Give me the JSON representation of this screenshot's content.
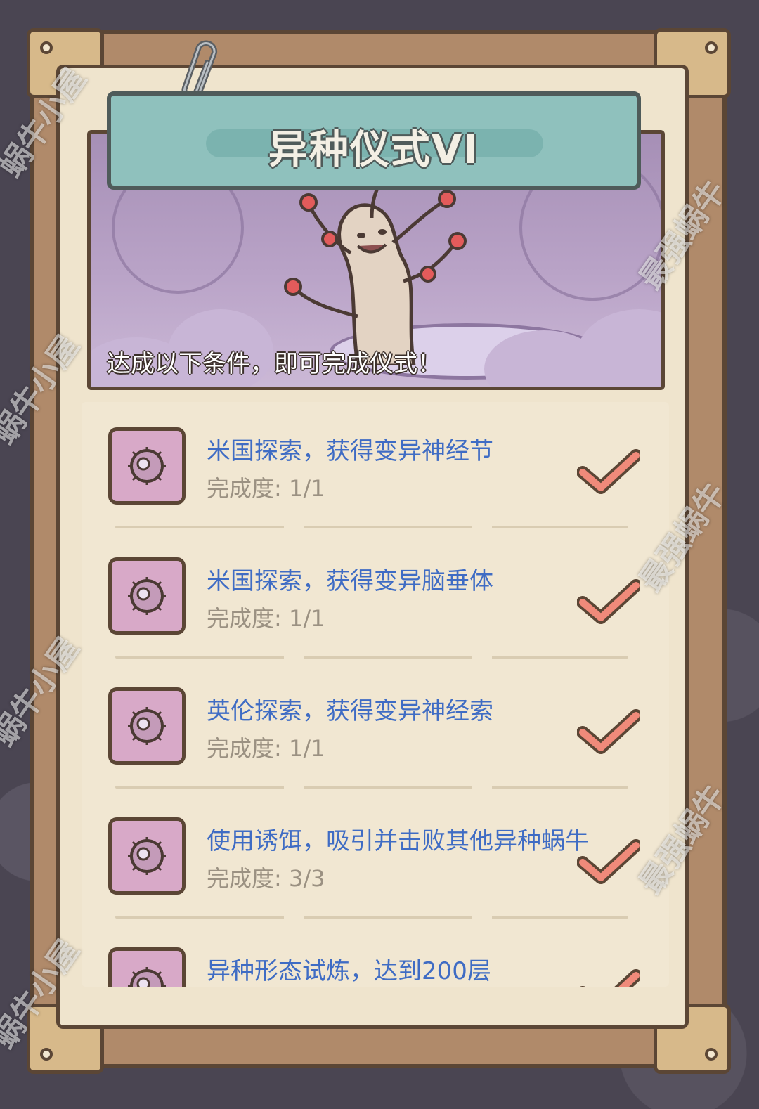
{
  "panel": {
    "title": "异种仪式VI",
    "subtitle": "达成以下条件，即可完成仪式！"
  },
  "conditions": [
    {
      "title": "米国探索，获得变异神经节",
      "progress_label": "完成度:",
      "progress": "1/1",
      "completed": true,
      "icon": "mutant-cell-icon"
    },
    {
      "title": "米国探索，获得变异脑垂体",
      "progress_label": "完成度:",
      "progress": "1/1",
      "completed": true,
      "icon": "mutant-cell-icon"
    },
    {
      "title": "英伦探索，获得变异神经索",
      "progress_label": "完成度:",
      "progress": "1/1",
      "completed": true,
      "icon": "mutant-cell-icon"
    },
    {
      "title": "使用诱饵，吸引并击败其他异种蜗牛",
      "progress_label": "完成度:",
      "progress": "3/3",
      "completed": true,
      "icon": "mutant-cell-icon"
    },
    {
      "title": "异种形态试炼，达到200层",
      "completed": true,
      "icon": "mutant-cell-icon"
    }
  ],
  "watermarks": [
    "蜗牛小屋",
    "最强蜗牛"
  ],
  "colors": {
    "title_plate": "#8fc1bd",
    "condition_text": "#3f6cc4",
    "progress_text": "#9b9182",
    "check": "#f08a7a",
    "icon_bg": "#d8a9c8"
  }
}
